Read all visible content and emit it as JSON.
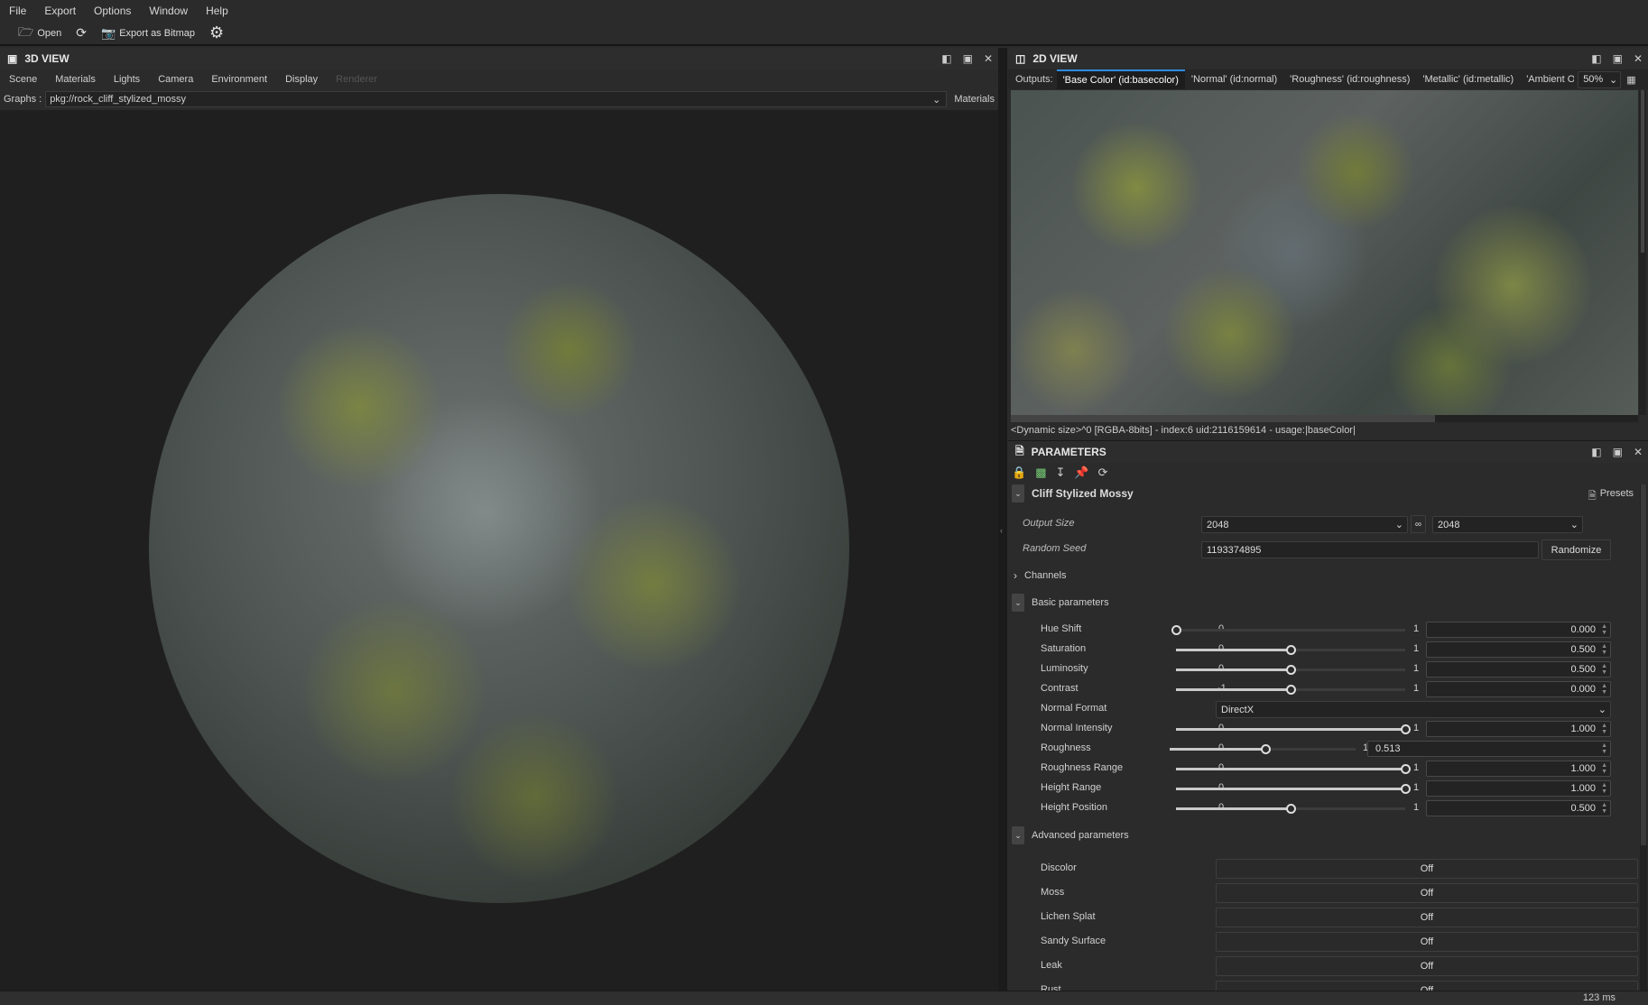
{
  "menu": [
    "File",
    "Export",
    "Options",
    "Window",
    "Help"
  ],
  "toolbar": {
    "open": "Open",
    "export": "Export as Bitmap"
  },
  "view3d": {
    "title": "3D VIEW",
    "menus": [
      "Scene",
      "Materials",
      "Lights",
      "Camera",
      "Environment",
      "Display",
      "Renderer"
    ],
    "graphs_label": "Graphs :",
    "graph_value": "pkg://rock_cliff_stylized_mossy",
    "materials_label": "Materials"
  },
  "view2d": {
    "title": "2D VIEW",
    "outputs_label": "Outputs:",
    "tabs": [
      "'Base Color' (id:basecolor)",
      "'Normal' (id:normal)",
      "'Roughness' (id:roughness)",
      "'Metallic' (id:metallic)",
      "'Ambient Oc"
    ],
    "active_tab": 0,
    "zoom": "50%",
    "info": "<Dynamic size>^0 [RGBA-8bits] - index:6 uid:2116159614 - usage:|baseColor|"
  },
  "parameters": {
    "title": "PARAMETERS",
    "graph_name": "Cliff Stylized Mossy",
    "presets": "Presets",
    "output_size_label": "Output Size",
    "output_size_w": "2048",
    "output_size_h": "2048",
    "random_seed_label": "Random Seed",
    "random_seed": "1193374895",
    "randomize": "Randomize",
    "channels": "Channels",
    "basic": "Basic parameters",
    "advanced": "Advanced parameters",
    "basic_params": [
      {
        "label": "Hue Shift",
        "min": "0",
        "max": "1",
        "value": "0.000",
        "fraction": 0
      },
      {
        "label": "Saturation",
        "min": "0",
        "max": "1",
        "value": "0.500",
        "fraction": 0.5
      },
      {
        "label": "Luminosity",
        "min": "0",
        "max": "1",
        "value": "0.500",
        "fraction": 0.5
      },
      {
        "label": "Contrast",
        "min": "-1",
        "max": "1",
        "value": "0.000",
        "fraction": 0.5
      },
      {
        "label": "Normal Format",
        "dropdown": "DirectX"
      },
      {
        "label": "Normal Intensity",
        "min": "0",
        "max": "1",
        "value": "1.000",
        "fraction": 1
      },
      {
        "label": "Roughness",
        "min": "0",
        "max": "1",
        "value": "0.513",
        "fraction": 0.513,
        "wide": true
      },
      {
        "label": "Roughness Range",
        "min": "0",
        "max": "1",
        "value": "1.000",
        "fraction": 1
      },
      {
        "label": "Height Range",
        "min": "0",
        "max": "1",
        "value": "1.000",
        "fraction": 1
      },
      {
        "label": "Height Position",
        "min": "0",
        "max": "1",
        "value": "0.500",
        "fraction": 0.5
      }
    ],
    "advanced_params": [
      {
        "label": "Discolor",
        "value": "Off"
      },
      {
        "label": "Moss",
        "value": "Off"
      },
      {
        "label": "Lichen Splat",
        "value": "Off"
      },
      {
        "label": "Sandy Surface",
        "value": "Off"
      },
      {
        "label": "Leak",
        "value": "Off"
      },
      {
        "label": "Rust",
        "value": "Off"
      }
    ]
  },
  "status": {
    "time": "123 ms"
  },
  "colors": {
    "accent": "#2f8ce0",
    "background": "#2b2b2b",
    "viewport": "#1f1f1f"
  }
}
